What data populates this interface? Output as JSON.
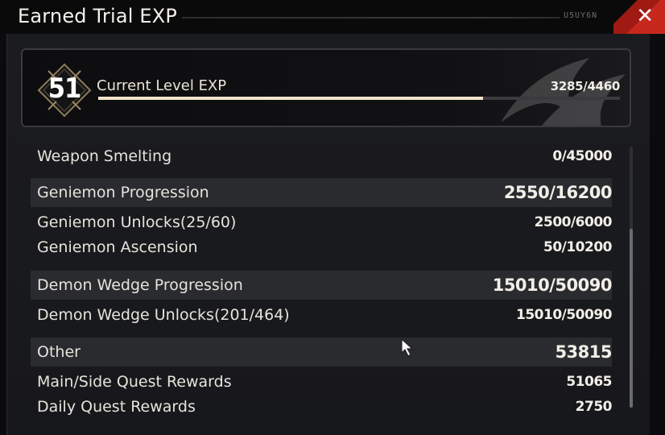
{
  "window": {
    "title": "Earned Trial EXP",
    "window_id": "U5UY6N",
    "close_icon": "close-icon"
  },
  "level": {
    "number": "51",
    "label": "Current Level EXP",
    "value": "3285/4460",
    "progress": 0.737
  },
  "rows": [
    {
      "label": "Weapon Smelting",
      "value": "0/45000",
      "header": false
    },
    {
      "label": "Geniemon Progression",
      "value": "2550/16200",
      "header": true
    },
    {
      "label": "Geniemon Unlocks(25/60)",
      "value": "2500/6000",
      "header": false
    },
    {
      "label": "Geniemon Ascension",
      "value": "50/10200",
      "header": false
    },
    {
      "label": "Demon Wedge Progression",
      "value": "15010/50090",
      "header": true
    },
    {
      "label": "Demon Wedge Unlocks(201/464)",
      "value": "15010/50090",
      "header": false
    },
    {
      "label": "Other",
      "value": "53815",
      "header": true
    },
    {
      "label": "Main/Side Quest Rewards",
      "value": "51065",
      "header": false
    },
    {
      "label": "Daily Quest Rewards",
      "value": "2750",
      "header": false
    }
  ],
  "colors": {
    "accent_close": "#c7281d",
    "exp_fill": "#f2e4cc",
    "header_row_bg": "#2a2b2f"
  }
}
